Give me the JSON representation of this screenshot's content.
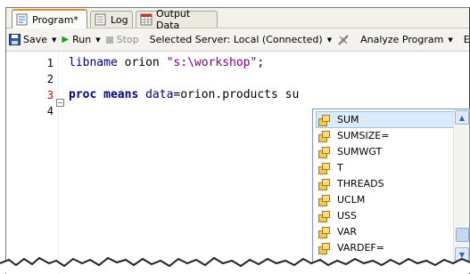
{
  "tabs": [
    {
      "label": "Program*",
      "icon": "program-icon",
      "active": true
    },
    {
      "label": "Log",
      "icon": "log-icon",
      "active": false
    },
    {
      "label": "Output Data",
      "icon": "output-data-icon",
      "active": false
    }
  ],
  "toolbar": {
    "save_label": "Save",
    "run_label": "Run",
    "stop_label": "Stop",
    "server_label": "Selected Server: Local (Connected)",
    "analyze_label": "Analyze Program",
    "overflow_label": "E"
  },
  "editor": {
    "line_numbers": [
      "1",
      "2",
      "3",
      "4"
    ],
    "line1": {
      "kw": "libname",
      "text": " orion ",
      "str": "\"s:\\workshop\"",
      "end": ";"
    },
    "line3": {
      "kw1": "proc means",
      "sp": " ",
      "kw2": "data",
      "rest": "=orion.products su"
    }
  },
  "autocomplete": {
    "items": [
      "SUM",
      "SUMSIZE=",
      "SUMWGT",
      "T",
      "THREADS",
      "UCLM",
      "USS",
      "VAR",
      "VARDEF="
    ],
    "selected": "SUM"
  }
}
